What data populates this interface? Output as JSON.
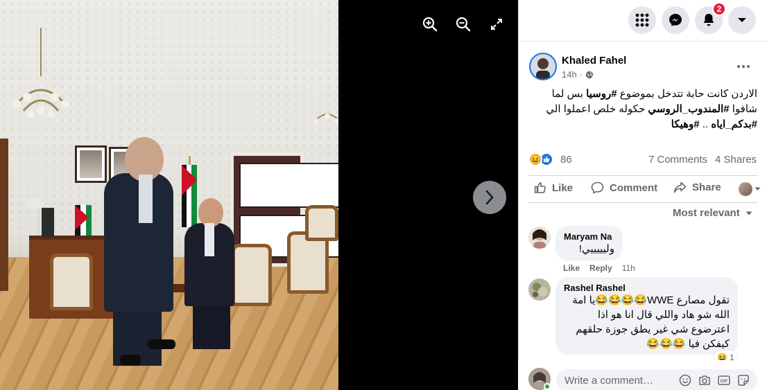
{
  "viewer": {
    "zoom_in": "zoom-in",
    "zoom_out": "zoom-out",
    "fullscreen": "fullscreen",
    "next": "next"
  },
  "topbar": {
    "notification_count": "2"
  },
  "post": {
    "author": "Khaled Fahel",
    "time": "14h",
    "text_line1_pre": "الاردن كانت حابة تتدخل بموضوع ",
    "text_line1_tag": "#روسيا",
    "text_line1_post": " بس لما",
    "text_line2_pre": "شافوا ",
    "text_line2_tag": "#المندوب_الروسي",
    "text_line2_post": " حكوله خلص اعملوا الي",
    "text_line3_tag1": "#بدكم_اياه",
    "text_line3_mid": " .. ",
    "text_line3_tag2": "#وهيكا",
    "reaction_count": "86",
    "comments": "7 Comments",
    "shares": "4 Shares"
  },
  "actions": {
    "like": "Like",
    "comment": "Comment",
    "share": "Share"
  },
  "sort_label": "Most relevant",
  "comments": [
    {
      "name": "Maryam Na",
      "text": "وليييييي!",
      "like": "Like",
      "reply": "Reply",
      "time": "11h"
    },
    {
      "name": "Rashel Rashel",
      "line1": "تقول مصارع WWE😂😂😂😂يا امة",
      "line2": "الله شو هاد واللي قال انا هو اذا",
      "line3": "اعترضوع شي غير يطق جوزة حلقهم",
      "line4": "كيفكن فيا 😂😂😂",
      "reaction_count": "1"
    }
  ],
  "write_comment": {
    "placeholder": "Write a comment…"
  },
  "colors": {
    "accent": "#1877f2",
    "badge": "#e41e3f",
    "online": "#31a24c"
  }
}
